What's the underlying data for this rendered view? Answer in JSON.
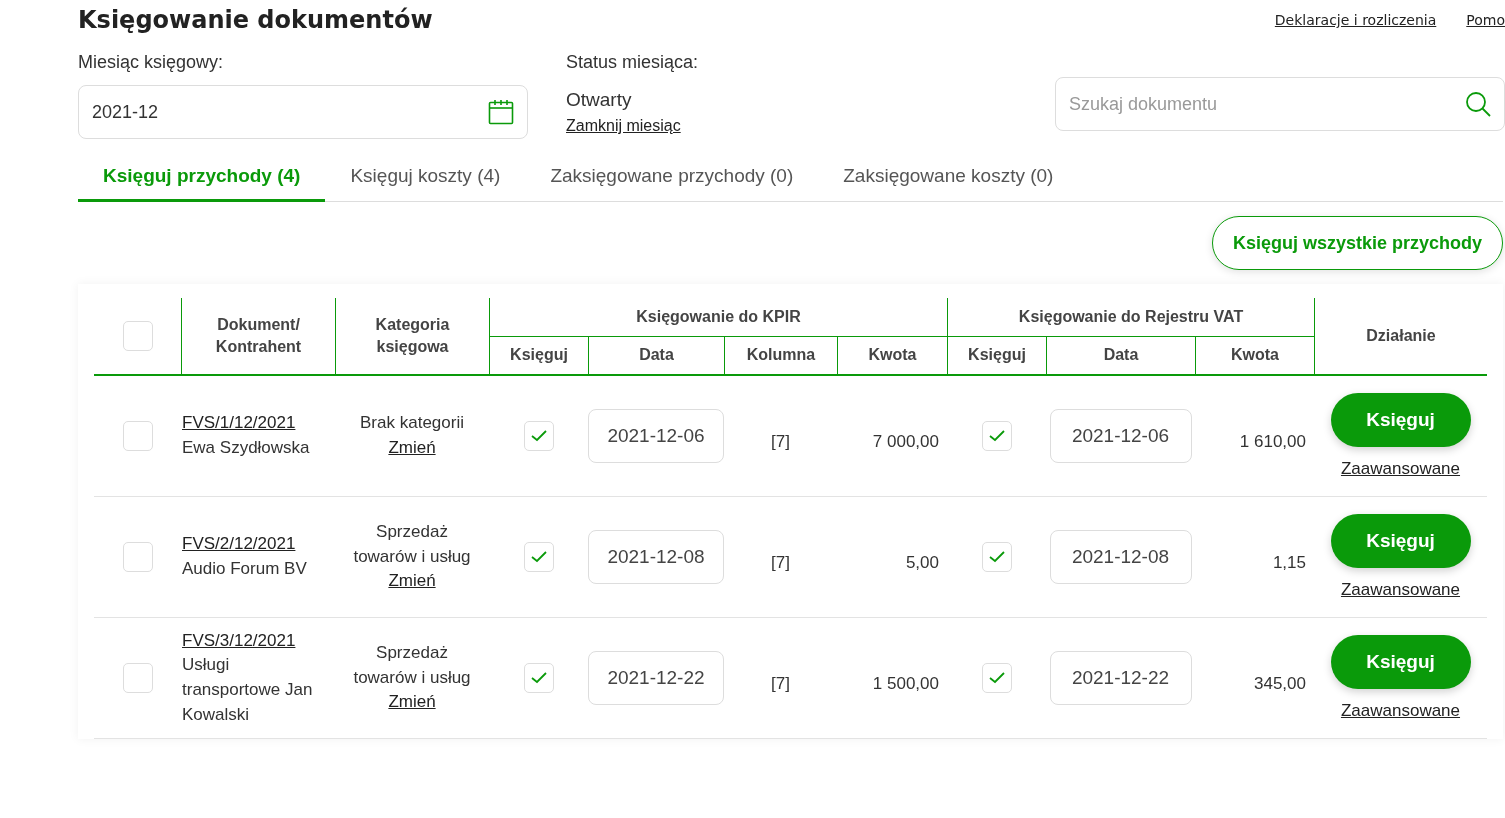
{
  "header": {
    "title": "Księgowanie dokumentów",
    "links": [
      "Deklaracje i rozliczenia",
      "Pomo"
    ]
  },
  "month": {
    "label": "Miesiąc księgowy:",
    "value": "2021-12"
  },
  "status": {
    "label": "Status miesiąca:",
    "value": "Otwarty",
    "link": "Zamknij miesiąc"
  },
  "search": {
    "placeholder": "Szukaj dokumentu"
  },
  "tabs": [
    {
      "label": "Księguj przychody (4)",
      "selected": true
    },
    {
      "label": "Księguj koszty (4)",
      "selected": false
    },
    {
      "label": "Zaksięgowane przychody (0)",
      "selected": false
    },
    {
      "label": "Zaksięgowane koszty (0)",
      "selected": false
    }
  ],
  "bulk_button": "Księguj wszystkie przychody",
  "table": {
    "select_all": false,
    "columns": {
      "document": "Dokument/ Kontrahent",
      "category": "Kategoria księgowa",
      "kpir_group": "Księgowanie do KPIR",
      "vat_group": "Księgowanie do Rejestru VAT",
      "action": "Działanie",
      "kpir": [
        "Księguj",
        "Data",
        "Kolumna",
        "Kwota"
      ],
      "vat": [
        "Księguj",
        "Data",
        "Kwota"
      ]
    },
    "rows": [
      {
        "selected": false,
        "document": "FVS/1/12/2021",
        "contractor": "Ewa Szydłowska",
        "category": "Brak kategorii",
        "change": "Zmień",
        "kpir_post": true,
        "kpir_date": "2021-12-06",
        "column": "[7]",
        "kpir_amount": "7 000,00",
        "vat_post": true,
        "vat_date": "2021-12-06",
        "vat_amount": "1 610,00",
        "button": "Księguj",
        "advanced": "Zaawansowane"
      },
      {
        "selected": false,
        "document": "FVS/2/12/2021",
        "contractor": "Audio Forum BV",
        "category": "Sprzedaż towarów i usług",
        "change": "Zmień",
        "kpir_post": true,
        "kpir_date": "2021-12-08",
        "column": "[7]",
        "kpir_amount": "5,00",
        "vat_post": true,
        "vat_date": "2021-12-08",
        "vat_amount": "1,15",
        "button": "Księguj",
        "advanced": "Zaawansowane"
      },
      {
        "selected": false,
        "document": "FVS/3/12/2021",
        "contractor": "Usługi transportowe Jan Kowalski",
        "category": "Sprzedaż towarów i usług",
        "change": "Zmień",
        "kpir_post": true,
        "kpir_date": "2021-12-22",
        "column": "[7]",
        "kpir_amount": "1 500,00",
        "vat_post": true,
        "vat_date": "2021-12-22",
        "vat_amount": "345,00",
        "button": "Księguj",
        "advanced": "Zaawansowane"
      }
    ]
  }
}
